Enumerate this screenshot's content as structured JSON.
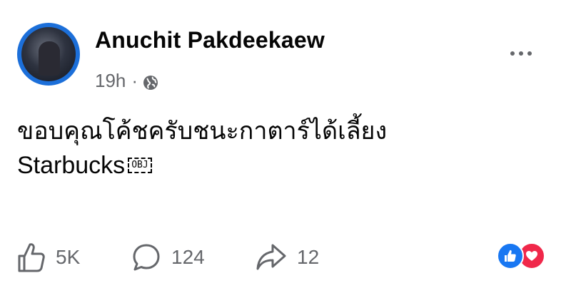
{
  "post": {
    "author": "Anuchit Pakdeekaew",
    "time": "19h",
    "separator": "·",
    "privacy_icon": "globe-icon",
    "text_line1": "ขอบคุณโค้ชครับชนะกาตาร์ได้เลี้ยง",
    "text_line2": "Starbucks",
    "obj_placeholder": "OBJ"
  },
  "actions": {
    "like_count": "5K",
    "comment_count": "124",
    "share_count": "12"
  },
  "icons": {
    "like": "thumbs-up-icon",
    "comment": "comment-icon",
    "share": "share-icon",
    "more": "more-options-icon"
  },
  "colors": {
    "like_reaction": "#1877f2",
    "love_reaction": "#f0284a",
    "secondary_text": "#65676b"
  }
}
